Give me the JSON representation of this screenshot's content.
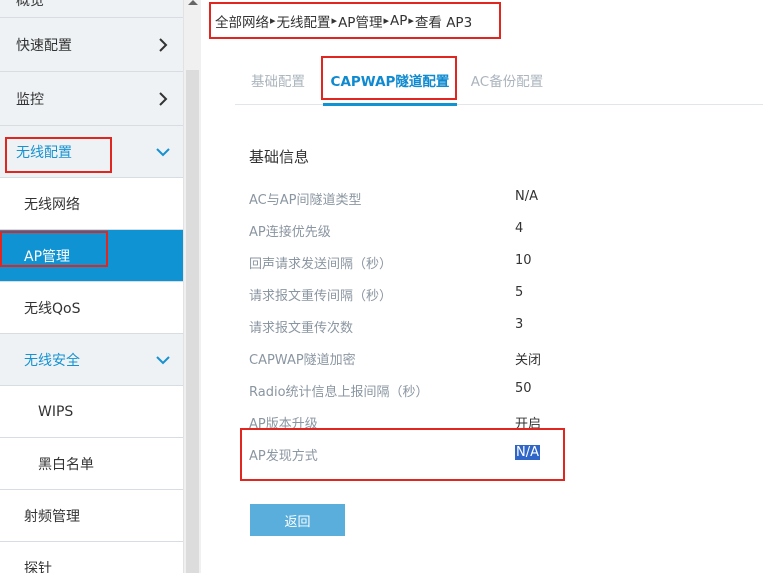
{
  "sidebar": {
    "items": [
      {
        "label": "概览"
      },
      {
        "label": "快速配置"
      },
      {
        "label": "监控"
      },
      {
        "label": "无线配置"
      },
      {
        "label": "无线网络"
      },
      {
        "label": "AP管理"
      },
      {
        "label": "无线QoS"
      },
      {
        "label": "无线安全"
      },
      {
        "label": "WIPS"
      },
      {
        "label": "黑白名单"
      },
      {
        "label": "射频管理"
      },
      {
        "label": "探针"
      }
    ]
  },
  "breadcrumb": {
    "items": [
      "全部网络",
      "无线配置",
      "AP管理",
      "AP",
      "查看 AP3"
    ],
    "separator": "▸"
  },
  "tabs": [
    {
      "label": "基础配置",
      "active": false
    },
    {
      "label": "CAPWAP隧道配置",
      "active": true
    },
    {
      "label": "AC备份配置",
      "active": false
    }
  ],
  "section": {
    "title": "基础信息",
    "rows": [
      {
        "label": "AC与AP间隧道类型",
        "value": "N/A"
      },
      {
        "label": "AP连接优先级",
        "value": "4"
      },
      {
        "label": "回声请求发送间隔（秒）",
        "value": "10"
      },
      {
        "label": "请求报文重传间隔（秒）",
        "value": "5"
      },
      {
        "label": "请求报文重传次数",
        "value": "3"
      },
      {
        "label": "CAPWAP隧道加密",
        "value": "关闭"
      },
      {
        "label": "Radio统计信息上报间隔（秒）",
        "value": "50"
      },
      {
        "label": "AP版本升级",
        "value": "开启"
      },
      {
        "label": "AP发现方式",
        "value": "N/A"
      }
    ]
  },
  "buttons": {
    "back": "返回"
  },
  "colors": {
    "accent": "#0f93d2",
    "highlight": "#e0261f",
    "selection": "#2f66c8"
  }
}
